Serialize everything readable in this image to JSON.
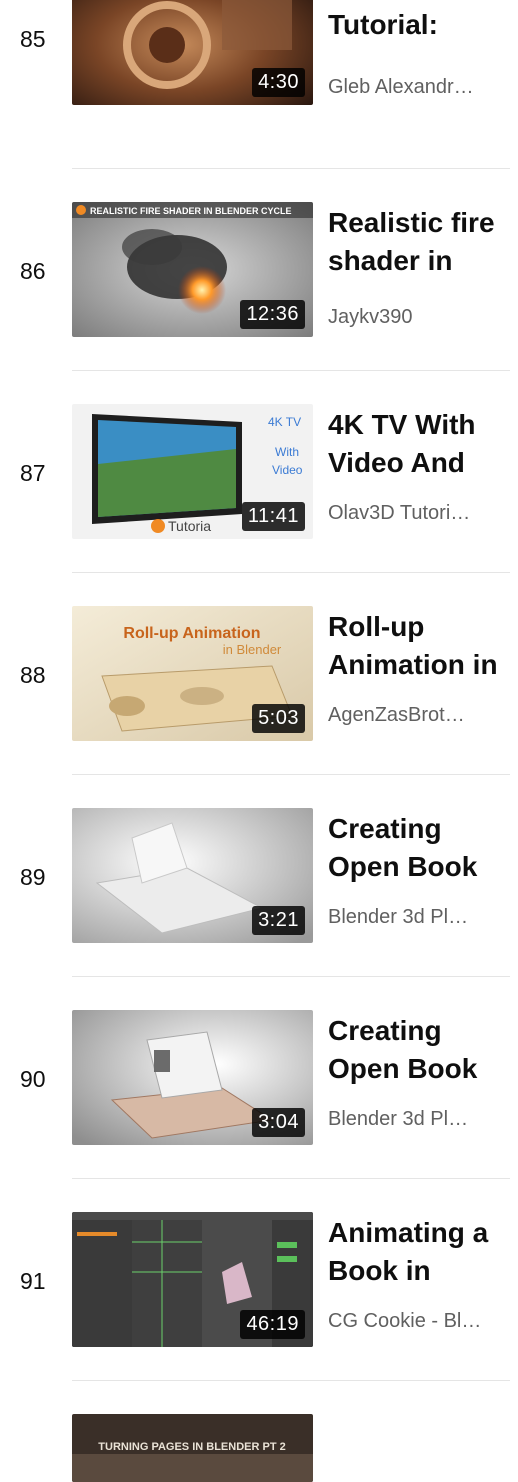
{
  "videos": [
    {
      "index": "85",
      "title": "Blender Tutorial:",
      "channel": "Gleb Alexandr…",
      "duration": "4:30"
    },
    {
      "index": "86",
      "title": "Realistic fire shader in",
      "channel": "Jaykv390",
      "duration": "12:36",
      "thumb_text": "REALISTIC FIRE SHADER IN BLENDER CYCLE"
    },
    {
      "index": "87",
      "title": "4K TV With Video And",
      "channel": "Olav3D Tutori…",
      "duration": "11:41",
      "thumb_text": "4K TV",
      "thumb_text2": "With",
      "thumb_text3": "Video",
      "thumb_text4": "Tutoria"
    },
    {
      "index": "88",
      "title": "Roll-up Animation in",
      "channel": "AgenZasBrot…",
      "duration": "5:03",
      "thumb_text": "Roll-up Animation",
      "thumb_text2": "in Blender"
    },
    {
      "index": "89",
      "title": "Creating Open Book",
      "channel": "Blender 3d Pl…",
      "duration": "3:21"
    },
    {
      "index": "90",
      "title": "Creating Open Book",
      "channel": "Blender 3d Pl…",
      "duration": "3:04"
    },
    {
      "index": "91",
      "title": "Animating a Book in",
      "channel": "CG Cookie - Bl…",
      "duration": "46:19"
    },
    {
      "index": "",
      "title": "",
      "channel": "",
      "duration": "",
      "thumb_text": "TURNING PAGES IN BLENDER PT 2"
    }
  ],
  "colors": {
    "duration_bg": "#000000",
    "title": "#0f0f0f",
    "channel": "#606060",
    "separator": "#e5e5e5"
  }
}
